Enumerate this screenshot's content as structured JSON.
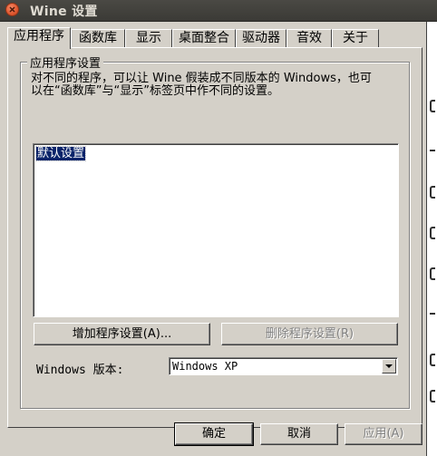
{
  "window": {
    "title": "Wine 设置"
  },
  "tabs": [
    {
      "label": "应用程序"
    },
    {
      "label": "函数库"
    },
    {
      "label": "显示"
    },
    {
      "label": "桌面整合"
    },
    {
      "label": "驱动器"
    },
    {
      "label": "音效"
    },
    {
      "label": "关于"
    }
  ],
  "app_settings": {
    "group_title": "应用程序设置",
    "description_line1": "对不同的程序，可以让 Wine 假装成不同版本的 Windows，也可",
    "description_line2": "以在“函数库”与“显示”标签页中作不同的设置。",
    "list_items": [
      {
        "label": "默认设置",
        "selected": true
      }
    ],
    "add_button": "增加程序设置(A)...",
    "remove_button": "删除程序设置(R)",
    "version_label": "Windows 版本:",
    "version_value": "Windows XP"
  },
  "footer": {
    "ok": "确定",
    "cancel": "取消",
    "apply": "应用(A)"
  },
  "colors": {
    "titlebar": "#3c3b37",
    "face": "#d4d0c8",
    "selection": "#0a246a"
  }
}
